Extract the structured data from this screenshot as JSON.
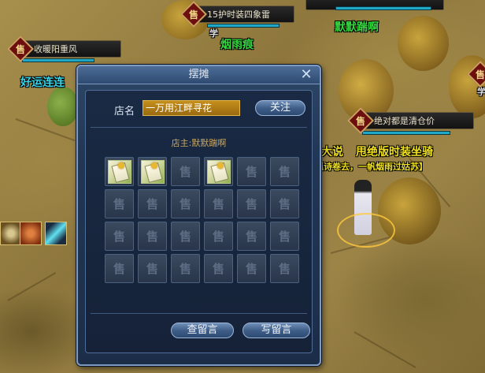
{
  "scene": {
    "stalls": [
      {
        "seal": "售",
        "name": "15护时装四象雷"
      },
      {
        "seal": "售",
        "name": "收暖阳重风"
      },
      {
        "seal": "售",
        "name": "绝对都是清仓价"
      }
    ],
    "player_names": {
      "xue_label": "学",
      "yanyuhen": "烟雨痕",
      "momo": "默默踹啊",
      "haoyun": "好运连连",
      "dashuo": "大说",
      "shout": "甩绝版时装坐骑",
      "poem": "瓢诗卷去，一帆烟雨过姑苏】",
      "right_edge_seal": "售",
      "right_edge_xue": "学"
    }
  },
  "dialog": {
    "title": "摆摊",
    "close_icon": "close-icon",
    "shop_name_label": "店名",
    "shop_name_value": "一万用江畔寻花",
    "follow_button": "关注",
    "owner_text": "店主:默默踹啊",
    "slot_placeholder": "售",
    "slots": [
      {
        "filled": true,
        "icon": "scroll-bundle-icon"
      },
      {
        "filled": true,
        "icon": "scroll-bundle-icon"
      },
      {
        "filled": false
      },
      {
        "filled": true,
        "icon": "scroll-bundle-icon"
      },
      {
        "filled": false
      },
      {
        "filled": false
      },
      {
        "filled": false
      },
      {
        "filled": false
      },
      {
        "filled": false
      },
      {
        "filled": false
      },
      {
        "filled": false
      },
      {
        "filled": false
      },
      {
        "filled": false
      },
      {
        "filled": false
      },
      {
        "filled": false
      },
      {
        "filled": false
      },
      {
        "filled": false
      },
      {
        "filled": false
      },
      {
        "filled": false
      },
      {
        "filled": false
      },
      {
        "filled": false
      },
      {
        "filled": false
      },
      {
        "filled": false
      },
      {
        "filled": false
      }
    ],
    "view_messages_button": "查留言",
    "write_message_button": "写留言"
  },
  "colors": {
    "accent_gold": "#c58f1c",
    "name_green": "#35d640",
    "name_cyan": "#38d4e8",
    "shout_yellow": "#f0e020"
  }
}
